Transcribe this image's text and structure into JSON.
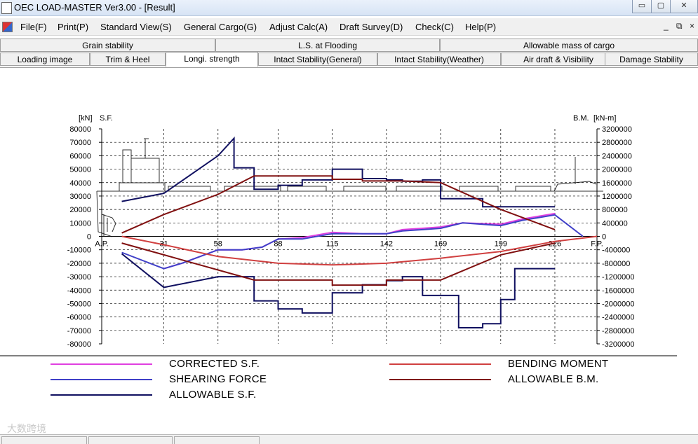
{
  "window": {
    "title": "OEC LOAD-MASTER Ver3.00 - [Result]",
    "controls": [
      "▭",
      "▢",
      "✕"
    ]
  },
  "menu": {
    "items": [
      "File(F)",
      "Print(P)",
      "Standard View(S)",
      "General Cargo(G)",
      "Adjust Calc(A)",
      "Draft Survey(D)",
      "Check(C)",
      "Help(P)"
    ],
    "mdi_controls": [
      "_",
      "⧉",
      "×"
    ]
  },
  "tabs": {
    "row1": [
      "Grain stability",
      "L.S. at Flooding",
      "Allowable mass of cargo"
    ],
    "row2": [
      "Loading image",
      "Trim & Heel",
      "Longi. strength",
      "Intact Stability(General)",
      "Intact Stability(Weather)",
      "Air draft & Visibility",
      "Damage Stability"
    ],
    "active": "Longi. strength"
  },
  "chart_data": {
    "type": "line",
    "left_axis": {
      "unit": "[kN]",
      "label": "S.F.",
      "ylim": [
        -80000,
        80000
      ],
      "ticks": [
        80000,
        70000,
        60000,
        50000,
        40000,
        30000,
        20000,
        10000,
        0,
        -10000,
        -20000,
        -30000,
        -40000,
        -50000,
        -60000,
        -70000,
        -80000
      ]
    },
    "right_axis": {
      "unit": "[kN-m]",
      "label": "B.M.",
      "ylim": [
        -3200000,
        3200000
      ],
      "ticks": [
        3200000,
        2800000,
        2400000,
        2000000,
        1600000,
        1200000,
        800000,
        400000,
        0,
        -400000,
        -800000,
        -1200000,
        -1600000,
        -2000000,
        -2400000,
        -2800000,
        -3200000
      ]
    },
    "x_axis": {
      "xlim": [
        0,
        247
      ],
      "ticks": [
        {
          "v": 0,
          "label": "A.P."
        },
        {
          "v": 31,
          "label": "31"
        },
        {
          "v": 58,
          "label": "58"
        },
        {
          "v": 88,
          "label": "88"
        },
        {
          "v": 115,
          "label": "115"
        },
        {
          "v": 142,
          "label": "142"
        },
        {
          "v": 169,
          "label": "169"
        },
        {
          "v": 199,
          "label": "199"
        },
        {
          "v": 226,
          "label": "226"
        },
        {
          "v": 247,
          "label": "F.P."
        }
      ]
    },
    "grid": true,
    "series": [
      {
        "name": "CORRECTED S.F.",
        "axis": "left",
        "color": "#e040e0",
        "x": [
          31,
          40,
          58,
          70,
          80,
          88,
          100,
          115,
          130,
          142,
          150,
          160,
          169,
          180,
          199,
          210,
          226
        ],
        "y": [
          -24000,
          -20000,
          -10000,
          -10000,
          -8000,
          -2000,
          -1000,
          3000,
          2000,
          2000,
          5000,
          6000,
          7000,
          10000,
          9000,
          13000,
          17000
        ]
      },
      {
        "name": "SHEARING FORCE",
        "axis": "left",
        "color": "#4040c8",
        "x": [
          10,
          31,
          40,
          58,
          70,
          80,
          88,
          100,
          115,
          130,
          142,
          150,
          160,
          169,
          180,
          199,
          210,
          226,
          240
        ],
        "y": [
          -12000,
          -24000,
          -20000,
          -10000,
          -10000,
          -8000,
          -2000,
          -2000,
          2000,
          2000,
          2000,
          4000,
          5000,
          6000,
          10000,
          8000,
          12000,
          16000,
          0
        ]
      },
      {
        "name": "ALLOWABLE S.F.",
        "axis": "left",
        "color": "#101060",
        "x": [
          10,
          31,
          58,
          66,
          66,
          76,
          76,
          88,
          88,
          100,
          100,
          115,
          115,
          130,
          130,
          142,
          142,
          150,
          150,
          160,
          160,
          169,
          169,
          178,
          178,
          190,
          190,
          199,
          199,
          206,
          206,
          214,
          214,
          226,
          226
        ],
        "y": [
          26000,
          32000,
          60000,
          73000,
          51000,
          51000,
          35000,
          35000,
          38000,
          38000,
          42000,
          42000,
          50000,
          50000,
          43000,
          43000,
          42000,
          42000,
          41000,
          41000,
          42000,
          42000,
          28000,
          28000,
          28000,
          28000,
          22000,
          22000,
          22000,
          22000,
          22000,
          22000,
          22000,
          22000,
          22000
        ]
      },
      {
        "name": "ALLOWABLE S.F. (lower)",
        "axis": "left",
        "color": "#101060",
        "x": [
          10,
          31,
          58,
          76,
          76,
          88,
          88,
          100,
          100,
          115,
          115,
          130,
          130,
          142,
          142,
          150,
          150,
          160,
          160,
          169,
          169,
          178,
          178,
          190,
          190,
          199,
          199,
          206,
          206,
          214,
          214,
          226
        ],
        "y": [
          -13000,
          -38000,
          -30000,
          -30000,
          -48000,
          -48000,
          -54000,
          -54000,
          -57000,
          -57000,
          -42000,
          -42000,
          -36000,
          -36000,
          -33000,
          -33000,
          -30000,
          -30000,
          -44000,
          -44000,
          -44000,
          -44000,
          -68000,
          -68000,
          -65000,
          -65000,
          -47000,
          -47000,
          -24000,
          -24000,
          -24000,
          -24000
        ]
      },
      {
        "name": "BENDING MOMENT",
        "axis": "right",
        "color": "#d04040",
        "x": [
          10,
          31,
          58,
          88,
          115,
          142,
          169,
          199,
          226,
          247
        ],
        "y": [
          0,
          -250000,
          -600000,
          -800000,
          -850000,
          -800000,
          -650000,
          -450000,
          -150000,
          0
        ]
      },
      {
        "name": "ALLOWABLE B.M.",
        "axis": "right",
        "color": "#801010",
        "x": [
          10,
          31,
          58,
          76,
          76,
          115,
          115,
          130,
          130,
          150,
          150,
          169,
          199,
          226
        ],
        "y": [
          100000,
          650000,
          1250000,
          1800000,
          1800000,
          1800000,
          1700000,
          1700000,
          1650000,
          1650000,
          1650000,
          1600000,
          800000,
          200000
        ]
      },
      {
        "name": "ALLOWABLE B.M. (lower)",
        "axis": "right",
        "color": "#801010",
        "x": [
          10,
          31,
          58,
          76,
          76,
          115,
          115,
          142,
          142,
          169,
          199,
          226
        ],
        "y": [
          -200000,
          -550000,
          -1000000,
          -1300000,
          -1300000,
          -1300000,
          -1450000,
          -1450000,
          -1300000,
          -1300000,
          -550000,
          -200000
        ]
      }
    ],
    "legend": [
      {
        "label": "CORRECTED S.F.",
        "color": "#e040e0"
      },
      {
        "label": "BENDING MOMENT",
        "color": "#d04040"
      },
      {
        "label": "SHEARING FORCE",
        "color": "#4040c8"
      },
      {
        "label": "ALLOWABLE B.M.",
        "color": "#801010"
      },
      {
        "label": "ALLOWABLE S.F.",
        "color": "#101060"
      }
    ]
  },
  "watermark": {
    "text": "大数跨境"
  }
}
